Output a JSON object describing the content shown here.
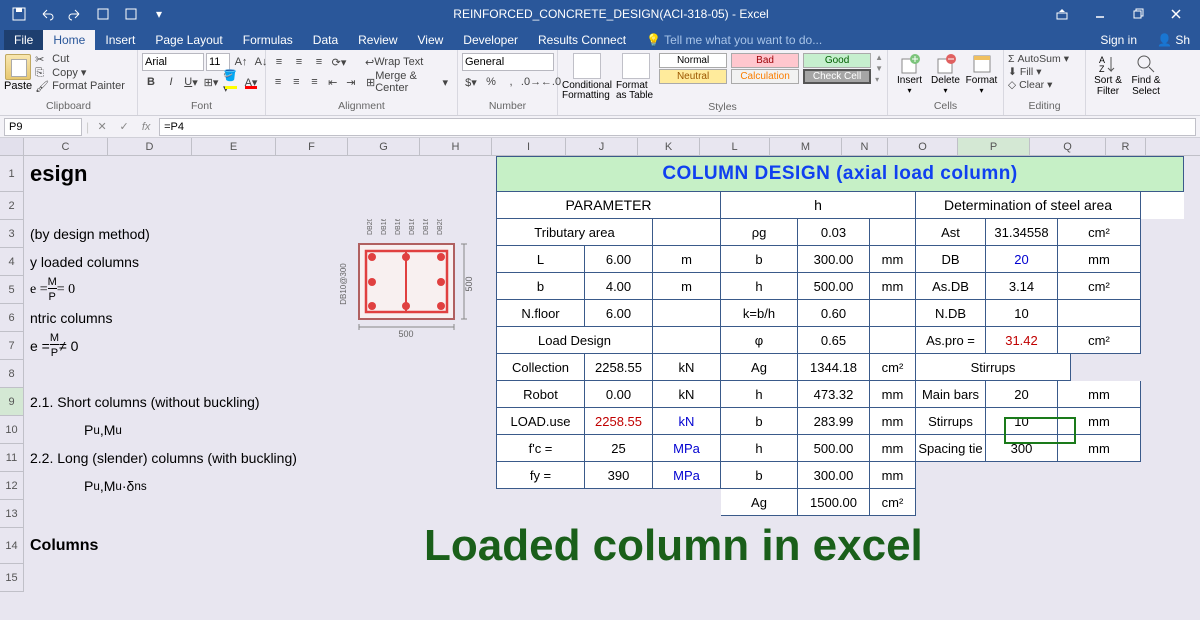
{
  "title": "REINFORCED_CONCRETE_DESIGN(ACI-318-05) - Excel",
  "tabs": {
    "file": "File",
    "home": "Home",
    "insert": "Insert",
    "pagelayout": "Page Layout",
    "formulas": "Formulas",
    "data": "Data",
    "review": "Review",
    "view": "View",
    "developer": "Developer",
    "results": "Results Connect",
    "tellme": "Tell me what you want to do...",
    "signin": "Sign in",
    "share": "Sh"
  },
  "clipboard": {
    "cut": "Cut",
    "copy": "Copy",
    "paint": "Format Painter",
    "paste": "Paste",
    "label": "Clipboard"
  },
  "font": {
    "name": "Arial",
    "size": "11",
    "label": "Font"
  },
  "alignment": {
    "wrap": "Wrap Text",
    "merge": "Merge & Center",
    "label": "Alignment"
  },
  "number": {
    "fmt": "General",
    "label": "Number"
  },
  "styles": {
    "cond": "Conditional Formatting",
    "fmtas": "Format as Table",
    "normal": "Normal",
    "bad": "Bad",
    "good": "Good",
    "neutral": "Neutral",
    "calc": "Calculation",
    "check": "Check Cell",
    "label": "Styles"
  },
  "cells": {
    "insert": "Insert",
    "delete": "Delete",
    "format": "Format",
    "label": "Cells"
  },
  "editing": {
    "sum": "AutoSum",
    "fill": "Fill",
    "clear": "Clear",
    "sort": "Sort & Filter",
    "find": "Find & Select",
    "label": "Editing"
  },
  "formulabar": {
    "name": "P9",
    "formula": "=P4"
  },
  "colheaders": [
    "C",
    "D",
    "E",
    "F",
    "G",
    "H",
    "I",
    "J",
    "K",
    "L",
    "M",
    "N",
    "O",
    "P",
    "Q",
    "R"
  ],
  "rowheaders": [
    "1",
    "2",
    "3",
    "4",
    "5",
    "6",
    "7",
    "8",
    "9",
    "10",
    "11",
    "12",
    "13",
    "14",
    "15"
  ],
  "left": {
    "r1": "esign",
    "r3": "(by design method)",
    "r4": "y loaded columns",
    "r6": "ntric columns",
    "r9": "2.1. Short columns (without buckling)",
    "r11": "2.2. Long (slender) columns (with buckling)",
    "r14": "Columns",
    "r10": "P",
    "r10a": "u",
    "r10b": ",M",
    "r10c": "u",
    "r12": "P",
    "r12a": "u",
    "r12b": ",M",
    "r12c": "u",
    "r12d": "·δ",
    "r12e": "ns"
  },
  "table": {
    "title": "COLUMN DESIGN (axial load column)",
    "h1": "PARAMETER",
    "h2": "h",
    "h3": "Determination of steel area",
    "trib": "Tributary area",
    "rho": "ρg",
    "rho_v": "0.03",
    "ast": "Ast",
    "ast_v": "31.34558",
    "cm2": "cm²",
    "L": "L",
    "L_v": "6.00",
    "m": "m",
    "b": "b",
    "b_v": "300.00",
    "mm": "mm",
    "DB": "DB",
    "DB_v": "20",
    "b2": "b",
    "b2_v": "4.00",
    "h": "h",
    "h_v": "500.00",
    "asdb": "As.DB",
    "asdb_v": "3.14",
    "nf": "N.floor",
    "nf_v": "6.00",
    "kbh": "k=b/h",
    "kbh_v": "0.60",
    "ndb": "N.DB",
    "ndb_v": "10",
    "ld": "Load Design",
    "phi": "φ",
    "phi_v": "0.65",
    "aspro": "As.pro =",
    "aspro_v": "31.42",
    "col": "Collection",
    "col_v": "2258.55",
    "kN": "kN",
    "ag": "Ag",
    "ag_v": "1344.18",
    "stir": "Stirrups",
    "rob": "Robot",
    "rob_v": "0.00",
    "h2_v": "473.32",
    "mb": "Main bars",
    "mb_v": "20",
    "luse": "LOAD.use",
    "luse_v": "2258.55",
    "b3": "b",
    "b3_v": "283.99",
    "st2": "Stirrups",
    "st2_v": "10",
    "fc": "f'c =",
    "fc_v": "25",
    "mpa": "MPa",
    "h3v": "h",
    "h3_v": "500.00",
    "spt": "Spacing tie",
    "spt_v": "300",
    "fy": "fy =",
    "fy_v": "390",
    "b4": "b",
    "b4_v": "300.00",
    "ag2": "Ag",
    "ag2_v": "1500.00"
  },
  "overlay": "Loaded column in excel",
  "diagram": {
    "w": "500",
    "h": "500",
    "rebar": "DB20",
    "stirrup": "DB10@300"
  }
}
